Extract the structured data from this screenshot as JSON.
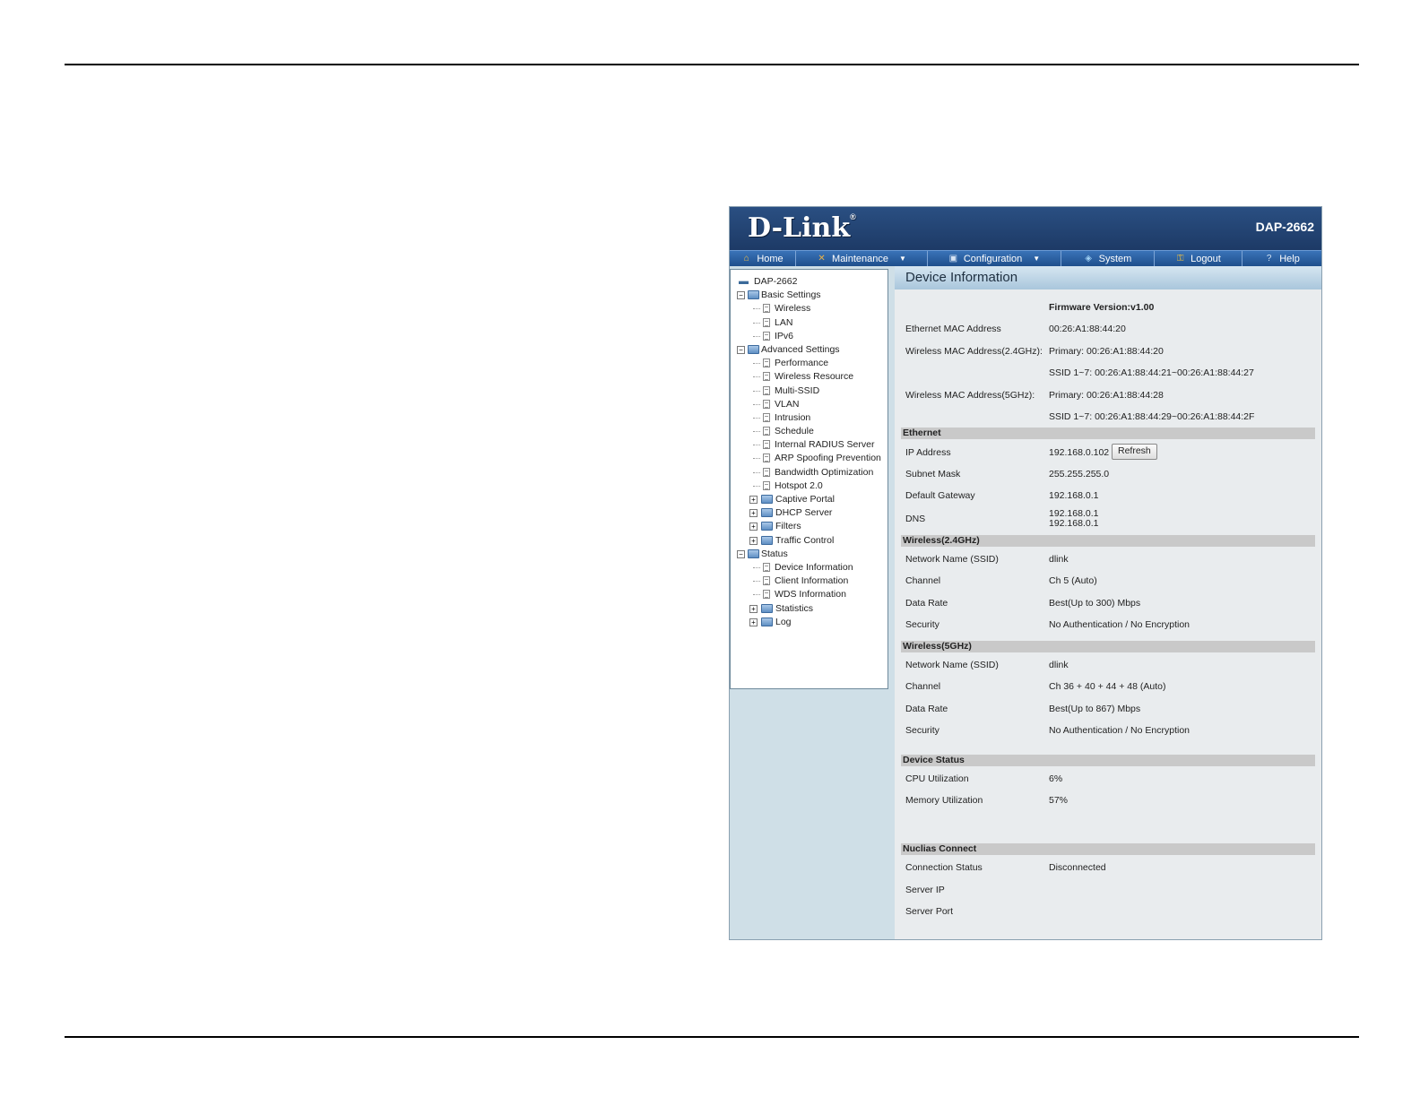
{
  "header": {
    "logo": "D-Link",
    "logo_mark": "®",
    "model": "DAP-2662"
  },
  "menu": [
    {
      "label": "Home",
      "icon": "home-icon"
    },
    {
      "label": "Maintenance",
      "icon": "tools-icon"
    },
    {
      "label": "Configuration",
      "icon": "floppy-icon"
    },
    {
      "label": "System",
      "icon": "network-icon"
    },
    {
      "label": "Logout",
      "icon": "key-icon"
    },
    {
      "label": "Help",
      "icon": "help-icon"
    }
  ],
  "tree": {
    "root": "DAP-2662",
    "basic": {
      "label": "Basic Settings",
      "items": [
        "Wireless",
        "LAN",
        "IPv6"
      ]
    },
    "advanced": {
      "label": "Advanced Settings",
      "items": [
        "Performance",
        "Wireless Resource",
        "Multi-SSID",
        "VLAN",
        "Intrusion",
        "Schedule",
        "Internal RADIUS Server",
        "ARP Spoofing Prevention",
        "Bandwidth Optimization",
        "Hotspot 2.0"
      ],
      "folders": [
        "Captive Portal",
        "DHCP Server",
        "Filters",
        "Traffic Control"
      ]
    },
    "status": {
      "label": "Status",
      "items": [
        "Device Information",
        "Client Information",
        "WDS Information"
      ],
      "folders": [
        "Statistics",
        "Log"
      ]
    }
  },
  "content": {
    "title": "Device Information",
    "firmware": "Firmware Version:v1.00",
    "eth_mac_label": "Ethernet MAC Address",
    "eth_mac": "00:26:A1:88:44:20",
    "wmac24_label": "Wireless MAC Address(2.4GHz):",
    "wmac24_primary": "Primary: 00:26:A1:88:44:20",
    "wmac24_ssid": "SSID 1~7: 00:26:A1:88:44:21~00:26:A1:88:44:27",
    "wmac5_label": "Wireless MAC Address(5GHz):",
    "wmac5_primary": "Primary: 00:26:A1:88:44:28",
    "wmac5_ssid": "SSID 1~7: 00:26:A1:88:44:29~00:26:A1:88:44:2F",
    "ethernet": {
      "heading": "Ethernet",
      "ip_label": "IP Address",
      "ip": "192.168.0.102",
      "refresh": "Refresh",
      "mask_label": "Subnet Mask",
      "mask": "255.255.255.0",
      "gw_label": "Default Gateway",
      "gw": "192.168.0.1",
      "dns_label": "DNS",
      "dns1": "192.168.0.1",
      "dns2": "192.168.0.1"
    },
    "w24": {
      "heading": "Wireless(2.4GHz)",
      "ssid_label": "Network Name (SSID)",
      "ssid": "dlink",
      "ch_label": "Channel",
      "ch": "Ch 5 (Auto)",
      "rate_label": "Data Rate",
      "rate": "Best(Up to 300) Mbps",
      "sec_label": "Security",
      "sec": "No Authentication / No Encryption"
    },
    "w5": {
      "heading": "Wireless(5GHz)",
      "ssid_label": "Network Name (SSID)",
      "ssid": "dlink",
      "ch_label": "Channel",
      "ch": "Ch 36 + 40 + 44 + 48 (Auto)",
      "rate_label": "Data Rate",
      "rate": "Best(Up to 867) Mbps",
      "sec_label": "Security",
      "sec": "No Authentication / No Encryption"
    },
    "device_status": {
      "heading": "Device Status",
      "cpu_label": "CPU Utilization",
      "cpu": "6%",
      "mem_label": "Memory Utilization",
      "mem": "57%"
    },
    "nuclias": {
      "heading": "Nuclias Connect",
      "conn_label": "Connection Status",
      "conn": "Disconnected",
      "ip_label": "Server IP",
      "port_label": "Server Port"
    }
  }
}
